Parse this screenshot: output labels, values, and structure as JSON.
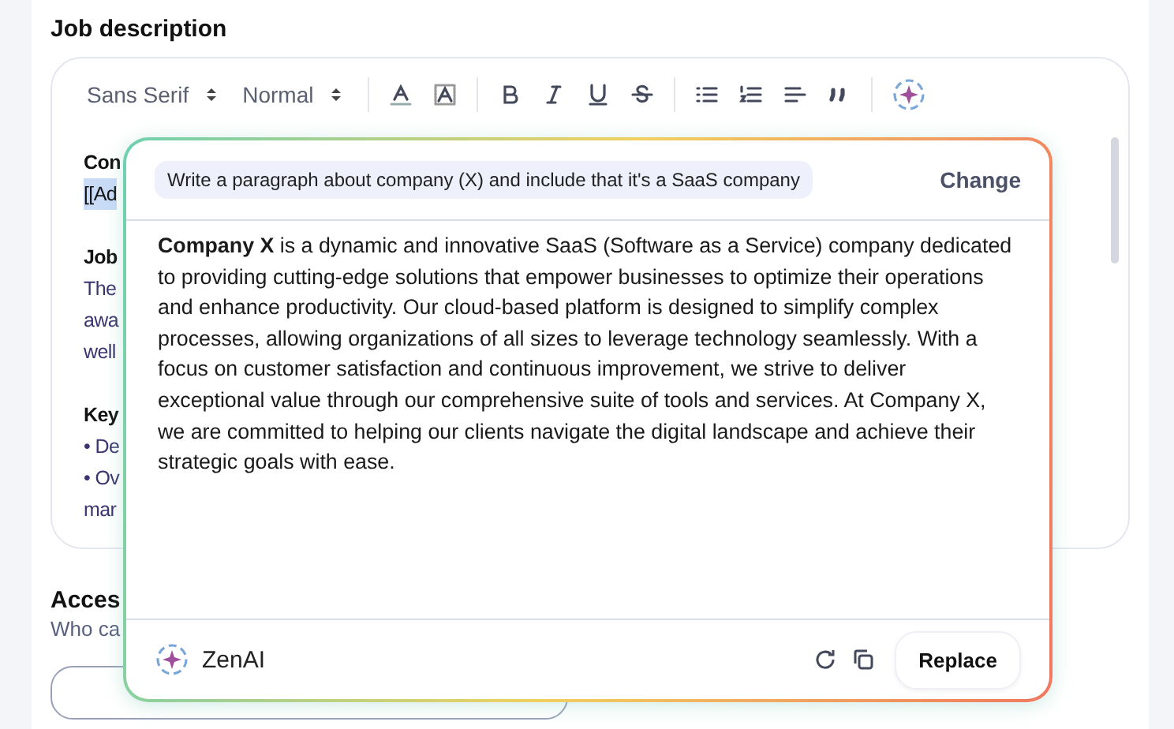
{
  "section_title": "Job description",
  "toolbar": {
    "font": "Sans Serif",
    "size": "Normal"
  },
  "editor_fragments": [
    {
      "kind": "bold",
      "text": "Con"
    },
    {
      "kind": "highlight",
      "text": "[[Ad"
    },
    {
      "kind": "gap"
    },
    {
      "kind": "bold",
      "text": "Job"
    },
    {
      "kind": "plain",
      "text": "The"
    },
    {
      "kind": "plain",
      "text": "awa"
    },
    {
      "kind": "plain",
      "text": "well"
    },
    {
      "kind": "gap"
    },
    {
      "kind": "bold",
      "text": "Key"
    },
    {
      "kind": "plain",
      "text": "• De"
    },
    {
      "kind": "plain",
      "text": "• Ov"
    },
    {
      "kind": "plain",
      "text": "mar"
    }
  ],
  "access": {
    "title": "Acces",
    "subtitle": "Who ca"
  },
  "ai_popup": {
    "prompt": "Write a paragraph about company (X) and include that it's a SaaS company",
    "change": "Change",
    "result": "**Company X** is a dynamic and innovative SaaS (Software as a Service) company dedicated to providing cutting-edge solutions that empower businesses to optimize their operations and enhance productivity. Our cloud-based platform is designed to simplify complex processes, allowing organizations of all sizes to leverage technology seamlessly. With a focus on customer satisfaction and continuous improvement, we strive to deliver exceptional value through our comprehensive suite of tools and services. At Company X, we are committed to helping our clients navigate the digital landscape and achieve their strategic goals with ease.",
    "brand": "ZenAI",
    "replace": "Replace"
  }
}
